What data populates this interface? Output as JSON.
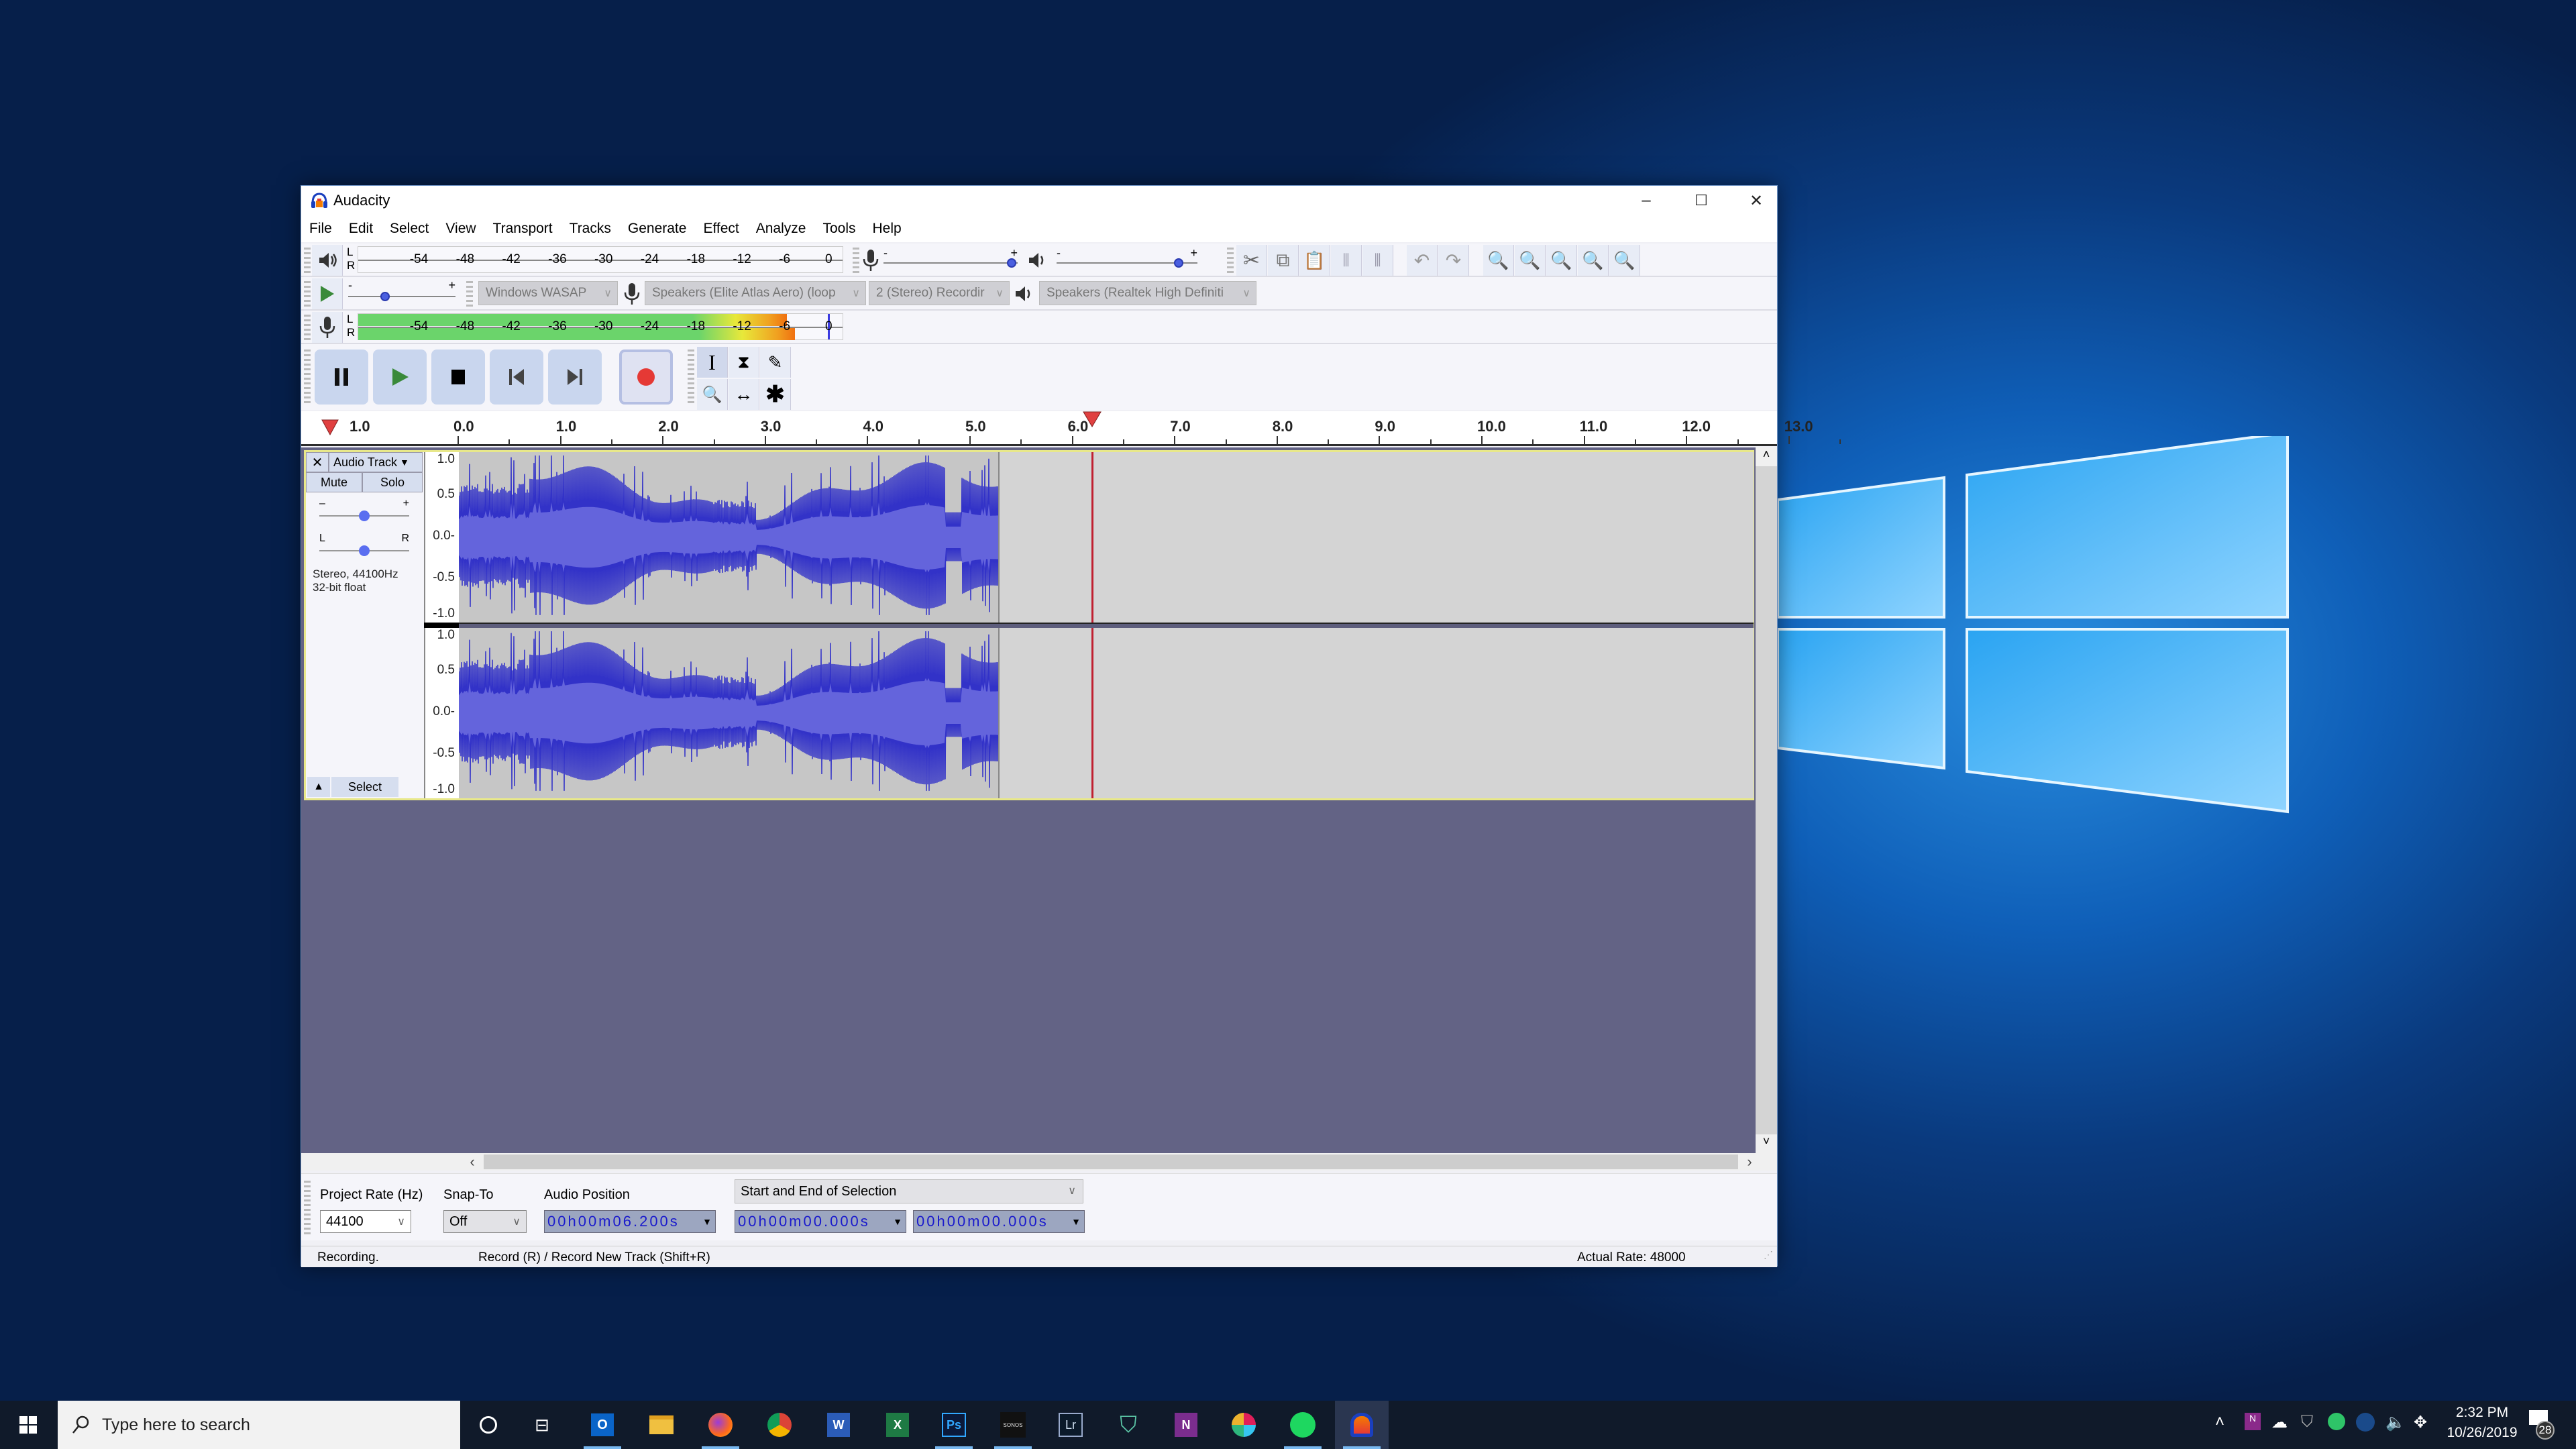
{
  "desktop": {
    "wallpaper": "Windows 10 default hero",
    "accent": "#0f5fb8"
  },
  "window": {
    "title": "Audacity",
    "controls": {
      "minimize": "–",
      "maximize": "☐",
      "close": "✕"
    }
  },
  "menu": [
    "File",
    "Edit",
    "Select",
    "View",
    "Transport",
    "Tracks",
    "Generate",
    "Effect",
    "Analyze",
    "Tools",
    "Help"
  ],
  "meters": {
    "ticks": [
      "-54",
      "-48",
      "-42",
      "-36",
      "-30",
      "-24",
      "-18",
      "-12",
      "-6",
      "0"
    ],
    "left_label": "L",
    "right_label": "R",
    "recording_level_left_db": -6,
    "recording_level_right_db": -5
  },
  "mixer": {
    "input_volume": 1.0,
    "output_volume": 0.9,
    "minus": "-",
    "plus": "+"
  },
  "playback_speed": {
    "minus": "-",
    "plus": "+",
    "value": 0.33
  },
  "devices": {
    "host": "Windows WASAP",
    "recording_device": "Speakers (Elite Atlas Aero) (loop",
    "channels": "2 (Stereo) Recordir",
    "playback_device": "Speakers (Realtek High Definiti"
  },
  "edit_toolbar": [
    "cut",
    "copy",
    "paste",
    "trim",
    "silence",
    "undo",
    "redo",
    "zoom-in",
    "zoom-out",
    "fit-selection",
    "fit-project",
    "zoom-toggle"
  ],
  "transport": [
    "pause",
    "play",
    "stop",
    "skip-start",
    "skip-end",
    "record"
  ],
  "tools": [
    "selection",
    "envelope",
    "draw",
    "zoom",
    "time-shift",
    "multi"
  ],
  "ruler": {
    "left_label": "1.0",
    "labels": [
      "0.0",
      "1.0",
      "2.0",
      "3.0",
      "4.0",
      "5.0",
      "6.0",
      "7.0",
      "8.0",
      "9.0",
      "10.0",
      "11.0",
      "12.0",
      "13.0"
    ],
    "playhead_seconds": 6.2
  },
  "track": {
    "name": "Audio Track",
    "close": "✕",
    "mute": "Mute",
    "solo": "Solo",
    "gain_minus": "–",
    "gain_plus": "+",
    "pan_left": "L",
    "pan_right": "R",
    "gain_value": 0.5,
    "pan_value": 0.5,
    "info_line1": "Stereo, 44100Hz",
    "info_line2": "32-bit float",
    "select": "Select",
    "collapse": "▲",
    "scale": [
      "1.0",
      "0.5",
      "0.0-",
      "-0.5",
      "-1.0"
    ],
    "recorded_seconds": 5.3
  },
  "selection_toolbar": {
    "project_rate_label": "Project Rate (Hz)",
    "project_rate": "44100",
    "snap_label": "Snap-To",
    "snap": "Off",
    "audio_position_label": "Audio Position",
    "audio_position": "00h00m06.200s",
    "selection_mode": "Start and End of Selection",
    "selection_start": "00h00m00.000s",
    "selection_end": "00h00m00.000s"
  },
  "status": {
    "state": "Recording.",
    "hint": "Record (R) / Record New Track (Shift+R)",
    "actual_rate": "Actual Rate: 48000"
  },
  "taskbar": {
    "search_placeholder": "Type here to search",
    "apps": [
      "cortana",
      "task-view",
      "outlook",
      "file-explorer",
      "firefox",
      "chrome",
      "word",
      "excel",
      "photoshop",
      "sonos",
      "lightroom",
      "security",
      "onenote",
      "slack",
      "spotify",
      "audacity"
    ],
    "clock_time": "2:32 PM",
    "clock_date": "10/26/2019",
    "notifications": "28"
  }
}
